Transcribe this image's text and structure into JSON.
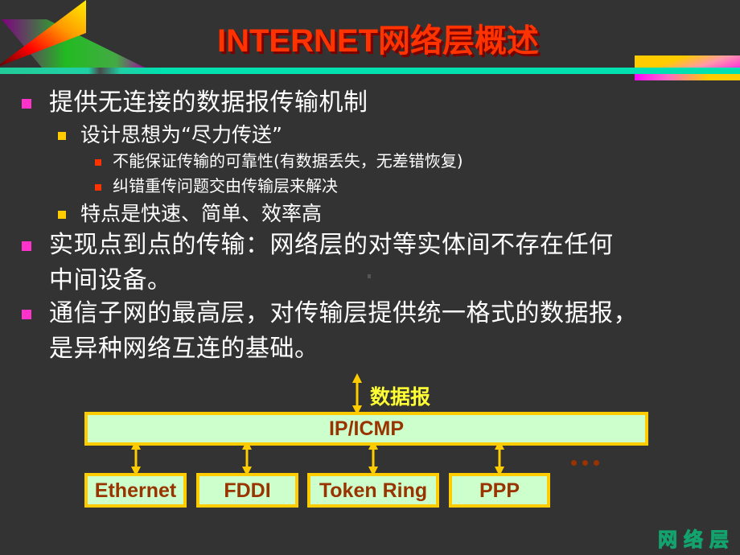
{
  "slide": {
    "title": "INTERNET网络层概述",
    "colors": {
      "background": "#333333",
      "title": "#ff3300",
      "rule": "#00e0b0",
      "bullet_level1": "#ff33cc",
      "bullet_level2": "#ffcc00",
      "bullet_level3": "#ff3300",
      "box_fill": "#ccffcc",
      "box_border": "#ffcc00",
      "box_text": "#993300",
      "label_text": "#ffff33"
    }
  },
  "bullets": [
    {
      "text": "提供无连接的数据报传输机制",
      "children": [
        {
          "text": "设计思想为“尽力传送”",
          "children": [
            {
              "text": "不能保证传输的可靠性(有数据丢失，无差错恢复)"
            },
            {
              "text": "纠错重传问题交由传输层来解决"
            }
          ]
        },
        {
          "text": "特点是快速、简单、效率高"
        }
      ]
    },
    {
      "lines": [
        "实现点到点的传输：网络层的对等实体间不存在任何",
        "中间设备。"
      ]
    },
    {
      "lines": [
        "通信子网的最高层，对传输层提供统一格式的数据报，",
        "是异种网络互连的基础。"
      ]
    }
  ],
  "diagram": {
    "top_label": "数据报",
    "main_layer": "IP/ICMP",
    "sub_layers": [
      "Ethernet",
      "FDDI",
      "Token Ring",
      "PPP"
    ],
    "ellipsis": "..."
  },
  "footer": {
    "watermark": "网络层"
  }
}
